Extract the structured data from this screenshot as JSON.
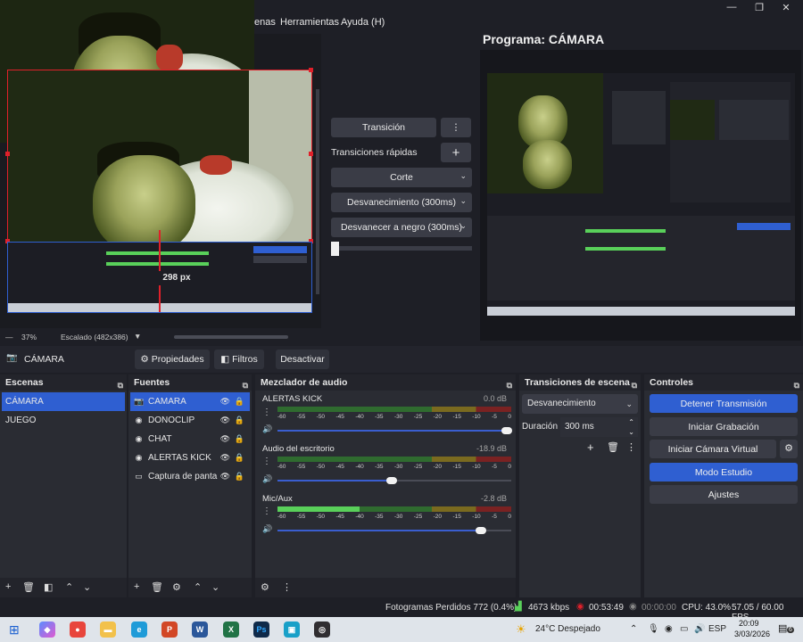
{
  "window": {
    "menu": [
      "enas",
      "Herramientas",
      "Ayuda (H)"
    ],
    "controls": [
      "—",
      "❐",
      "✕"
    ]
  },
  "program": {
    "title": "Programa: CÁMARA"
  },
  "preview": {
    "size_label": "298 px",
    "zoom": "37%",
    "scale_label": "Escalado (482x386)"
  },
  "transition_panel": {
    "transition_label": "Transición",
    "quick_label": "Transiciones rápidas",
    "items": [
      "Corte",
      "Desvanecimiento (300ms)",
      "Desvanecer a negro (300ms)"
    ]
  },
  "source_toolbar": {
    "source": "CÁMARA",
    "properties": "Propiedades",
    "filters": "Filtros",
    "deactivate": "Desactivar"
  },
  "scenes": {
    "title": "Escenas",
    "items": [
      "CÁMARA",
      "JUEGO"
    ]
  },
  "sources": {
    "title": "Fuentes",
    "items": [
      "CAMARA",
      "DONOCLIP",
      "CHAT",
      "ALERTAS KICK",
      "Captura de panta"
    ]
  },
  "mixer": {
    "title": "Mezclador de audio",
    "scale": [
      "-60",
      "-55",
      "-50",
      "-45",
      "-40",
      "-35",
      "-30",
      "-25",
      "-20",
      "-15",
      "-10",
      "-5",
      "0"
    ],
    "channels": [
      {
        "name": "ALERTAS KICK",
        "db": "0.0 dB",
        "level": 0.0,
        "volume": 0.98
      },
      {
        "name": "Audio del escritorio",
        "db": "-18.9 dB",
        "level": 0.0,
        "volume": 0.49
      },
      {
        "name": "Mic/Aux",
        "db": "-2.8 dB",
        "level": 0.35,
        "volume": 0.87
      }
    ]
  },
  "scene_transitions": {
    "title": "Transiciones de escena",
    "selected": "Desvanecimiento",
    "duration_label": "Duración",
    "duration_value": "300 ms"
  },
  "controls": {
    "title": "Controles",
    "buttons": [
      "Detener Transmisión",
      "Iniciar Grabación",
      "Iniciar Cámara Virtual",
      "Modo Estudio",
      "Ajustes"
    ]
  },
  "status": {
    "dropped": "Fotogramas Perdidos 772 (0.4%)",
    "bitrate": "4673 kbps",
    "stream_time": "00:53:49",
    "rec_time": "00:00:00",
    "cpu": "CPU: 43.0%",
    "fps": "57.05 / 60.00 FPS"
  },
  "taskbar": {
    "weather": "24°C Despejado",
    "lang": "ESP",
    "time": "20:09",
    "date": "3/03/2026",
    "notif": "6"
  },
  "colors": {
    "accent": "#2f5fd1",
    "live_red": "#e0202a"
  }
}
